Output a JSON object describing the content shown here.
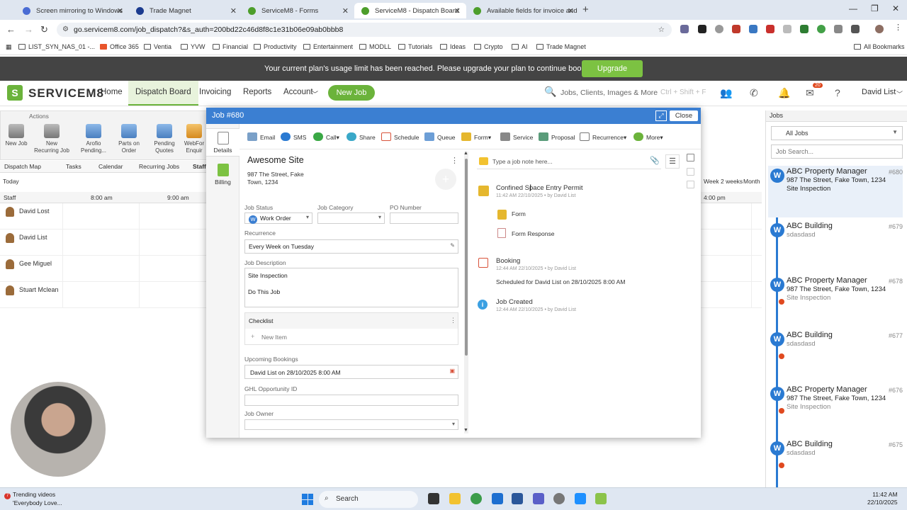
{
  "browser": {
    "tabs": [
      {
        "label": "Screen mirroring to Windows",
        "color": "#4a6cd4"
      },
      {
        "label": "Trade Magnet",
        "color": "#1b3b8f"
      },
      {
        "label": "ServiceM8 - Forms",
        "color": "#4d9e2b"
      },
      {
        "label": "ServiceM8 - Dispatch Board",
        "color": "#4d9e2b"
      },
      {
        "label": "Available fields for invoice and",
        "color": "#4d9e2b"
      }
    ],
    "url": "go.servicem8.com/job_dispatch?&s_auth=200bd22c46d8f8c1e31b06e09ab0bbb8",
    "bookmarks": [
      "LIST_SYN_NAS_01 -...",
      "Office 365",
      "Ventia",
      "YVW",
      "Financial",
      "Productivity",
      "Entertainment",
      "MODLL",
      "Tutorials",
      "Ideas",
      "Crypto",
      "AI",
      "Trade Magnet"
    ],
    "all_bookmarks": "All Bookmarks"
  },
  "banner": {
    "message": "Your current plan's usage limit has been reached. Please upgrade your plan to continue booking jobs.",
    "button": "Upgrade"
  },
  "nav": {
    "logo": "SERVICEM8",
    "logo_mark": "S",
    "links": [
      "Home",
      "Dispatch Board",
      "Invoicing",
      "Reports",
      "Account"
    ],
    "new_job": "New Job",
    "search_placeholder": "Jobs, Clients, Images & More",
    "search_shortcut": "Ctrl + Shift + F",
    "user": "David List",
    "inbox_badge": "20"
  },
  "board": {
    "actions_label": "Actions",
    "actions": [
      "New Job",
      "New Recurring Job",
      "Arofio Pending...",
      "Parts on Order",
      "Pending Quotes",
      "WebFor Enquir"
    ],
    "subtabs": [
      "Dispatch Map",
      "Tasks",
      "Calendar",
      "Recurring Jobs",
      "Staff"
    ],
    "today": "Today",
    "staff_header": "Staff",
    "times": [
      "8:00 am",
      "9:00 am",
      "4:00 pm"
    ],
    "views": [
      "Week",
      "2 weeks",
      "Month"
    ],
    "staff": [
      "David Lost",
      "David List",
      "Gee Miguel",
      "Stuart Mclean"
    ]
  },
  "jobs_panel": {
    "title": "Jobs",
    "filter": "All Jobs",
    "search_placeholder": "Job Search...",
    "jobs": [
      {
        "client": "ABC Property Manager",
        "number": "#680",
        "address": "987 The Street, Fake Town, 1234",
        "desc": "Site Inspection"
      },
      {
        "client": "ABC Building",
        "number": "#679",
        "address": "",
        "desc": "sdasdasd"
      },
      {
        "client": "ABC Property Manager",
        "number": "#678",
        "address": "987 The Street, Fake Town, 1234",
        "desc": "Site Inspection"
      },
      {
        "client": "ABC Building",
        "number": "#677",
        "address": "",
        "desc": "sdasdasd"
      },
      {
        "client": "ABC Property Manager",
        "number": "#676",
        "address": "987 The Street, Fake Town, 1234",
        "desc": "Site Inspection"
      },
      {
        "client": "ABC Building",
        "number": "#675",
        "address": "",
        "desc": "sdasdasd"
      }
    ]
  },
  "modal": {
    "title": "Job #680",
    "close": "Close",
    "rail": [
      "Details",
      "Billing"
    ],
    "toolbar": [
      "Email",
      "SMS",
      "Call",
      "Share",
      "Schedule",
      "Queue",
      "Form",
      "Service",
      "Proposal",
      "Recurrence",
      "More"
    ],
    "site_name": "Awesome Site",
    "site_address": "987 The Street, Fake Town, 1234",
    "fields": {
      "status_label": "Job Status",
      "status_value": "Work Order",
      "status_badge": "W",
      "category_label": "Job Category",
      "po_label": "PO Number",
      "recurrence_label": "Recurrence",
      "recurrence_value": "Every Week on Tuesday",
      "description_label": "Job Description",
      "description_line1": "Site Inspection",
      "description_line2": "Do This Job",
      "checklist_title": "Checklist",
      "checklist_new": "New Item",
      "upcoming_label": "Upcoming Bookings",
      "upcoming_value": "David List on 28/10/2025 8:00 AM",
      "ghl_label": "GHL Opportunity ID",
      "owner_label": "Job Owner"
    },
    "note_placeholder": "Type a job note here...",
    "activity": [
      {
        "title": "Confined Space Entry Permit",
        "meta": "11:42 AM 22/10/2025 • by David List"
      },
      {
        "title": "Form",
        "meta": ""
      },
      {
        "title": "Form Response",
        "meta": ""
      },
      {
        "title": "Booking",
        "meta": "12:44 AM 22/10/2025 • by David List",
        "detail": "Scheduled for David List on 28/10/2025 8:00 AM"
      },
      {
        "title": "Job Created",
        "meta": "12:44 AM 22/10/2025 • by David List"
      }
    ]
  },
  "taskbar": {
    "news_title": "Trending videos",
    "news_sub": "'Everybody Love...",
    "news_badge": "7",
    "search": "Search",
    "time": "11:42 AM",
    "date": "22/10/2025"
  }
}
